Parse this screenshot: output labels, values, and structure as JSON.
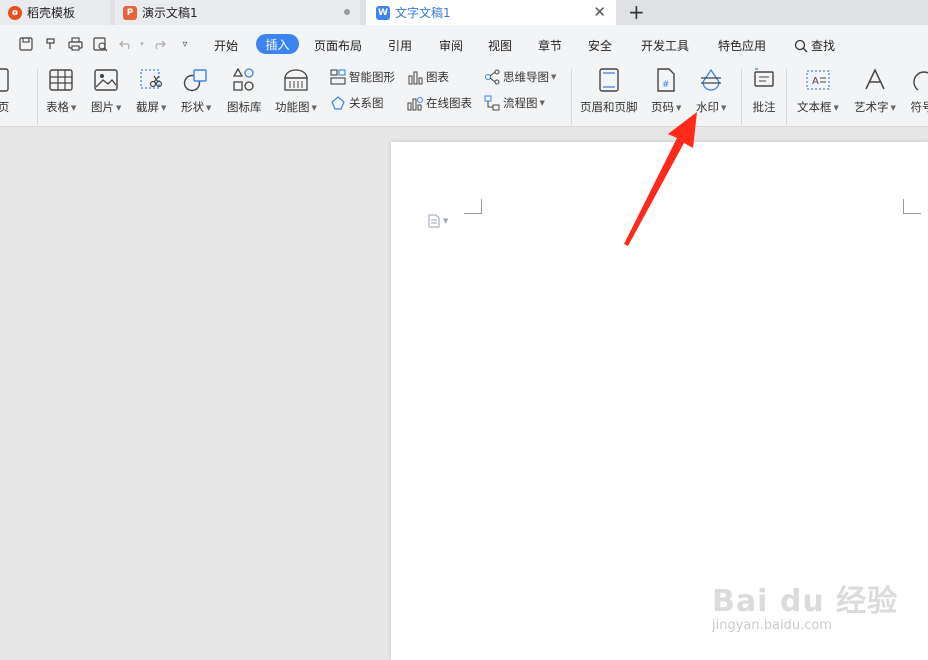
{
  "tabs": [
    {
      "label": "稻壳模板",
      "icon": "docer-icon",
      "color": "#e8501b"
    },
    {
      "label": "演示文稿1",
      "icon": "presentation-icon",
      "color": "#e8633a"
    },
    {
      "label": "文字文稿1",
      "icon": "writer-icon",
      "color": "#3c84f0"
    }
  ],
  "quick_access": [
    "save-icon",
    "format-painter-icon",
    "print-icon",
    "print-preview-icon",
    "undo-icon",
    "redo-icon",
    "customize-dropdown-icon"
  ],
  "menu": {
    "items": [
      "开始",
      "插入",
      "页面布局",
      "引用",
      "审阅",
      "视图",
      "章节",
      "安全",
      "开发工具",
      "特色应用"
    ],
    "active": "插入",
    "search_label": "查找"
  },
  "ribbon": {
    "cover_page": "封面页",
    "table": "表格",
    "picture": "图片",
    "screenshot": "截屏",
    "shape": "形状",
    "icon_lib": "图标库",
    "func_chart": "功能图",
    "smart_shape": "智能图形",
    "chart": "图表",
    "relation": "关系图",
    "online_chart": "在线图表",
    "mindmap": "思维导图",
    "flowchart": "流程图",
    "header_footer": "页眉和页脚",
    "page_number": "页码",
    "watermark": "水印",
    "comment": "批注",
    "textbox": "文本框",
    "wordart": "艺术字",
    "symbol": "符号"
  },
  "watermark_overlay": {
    "big": "Bai du 经验",
    "small": "jingyan.baidu.com"
  },
  "colors": {
    "accent": "#3c84f0",
    "arrow": "#ff2a1a"
  }
}
